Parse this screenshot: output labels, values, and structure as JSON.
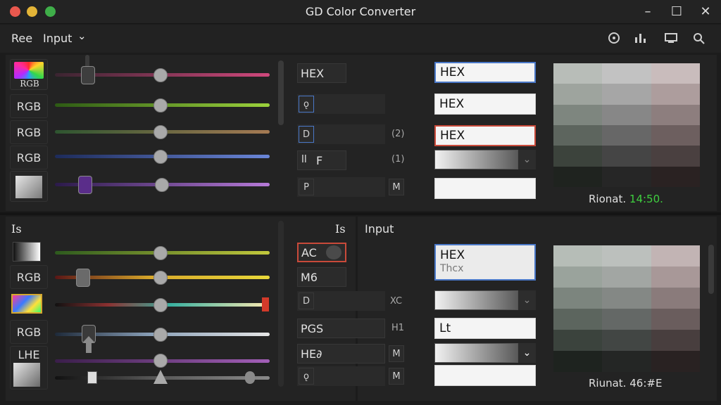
{
  "window": {
    "title": "GD Color Converter"
  },
  "menubar": {
    "item1": "Ree",
    "item2": "Input",
    "chevron": "⌄"
  },
  "toolbar_icons": [
    "palette-icon",
    "chart-icon",
    "monitor-icon",
    "search-icon"
  ],
  "top_left": {
    "rows": [
      "RGB",
      "RGB",
      "RGB",
      "RGB"
    ],
    "first_swatch_label": "RGB"
  },
  "top_mid": {
    "fields": [
      "HEX",
      "",
      "",
      "F",
      ""
    ],
    "icon_letters": [
      "",
      "ǫ",
      "D",
      "ll",
      "P"
    ],
    "pills": [
      "",
      "",
      "(2)",
      "(1)",
      "M"
    ]
  },
  "top_right": {
    "inputs": [
      "HEX",
      "HEX",
      "HEX"
    ],
    "caption_label": "Rionat.",
    "caption_value": "14:50.",
    "caption_value_color": "#3fcf3f"
  },
  "bottom": {
    "left_label": "Is",
    "mid_label": "Is",
    "right_label": "Input",
    "swatch_labels": [
      "",
      "RGB",
      "",
      "RGB",
      "LHE",
      ""
    ],
    "fields": [
      "AC",
      "M6",
      "D",
      "PGS",
      "HE∂",
      "ǫ"
    ],
    "pills": [
      "",
      "",
      "XC",
      "H1",
      "M",
      "M"
    ],
    "hex_box_line1": "HEX",
    "hex_box_line2": "Thcx",
    "text_input": "Lt",
    "caption_label": "Riunat.",
    "caption_value": "46:#E"
  },
  "colors": {
    "accent_blue": "#4a78c8",
    "accent_red": "#c94a3a",
    "caption_green": "#3fcf3f"
  }
}
